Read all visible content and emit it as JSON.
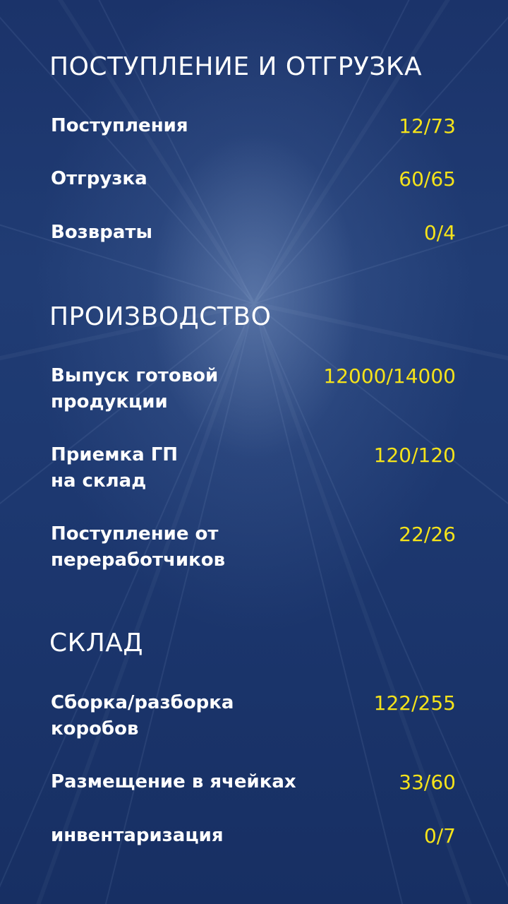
{
  "colors": {
    "background": "#1d3870",
    "heading": "#ffffff",
    "label": "#ffffff",
    "value": "#f5e31a"
  },
  "sections": [
    {
      "title": "ПОСТУПЛЕНИЕ И ОТГРУЗКА",
      "rows": [
        {
          "label": "Поступления",
          "value": "12/73"
        },
        {
          "label": "Отгрузка",
          "value": "60/65"
        },
        {
          "label": "Возвраты",
          "value": "0/4"
        }
      ]
    },
    {
      "title": "ПРОИЗВОДСТВО",
      "rows": [
        {
          "label": "Выпуск готовой\nпродукции",
          "value": "12000/14000"
        },
        {
          "label": "Приемка ГП\nна склад",
          "value": "120/120"
        },
        {
          "label": "Поступление от\nпереработчиков",
          "value": "22/26"
        }
      ]
    },
    {
      "title": "СКЛАД",
      "rows": [
        {
          "label": "Сборка/разборка\nкоробов",
          "value": "122/255"
        },
        {
          "label": "Размещение в ячейках",
          "value": "33/60"
        },
        {
          "label": "инвентаризация",
          "value": "0/7"
        }
      ]
    }
  ]
}
